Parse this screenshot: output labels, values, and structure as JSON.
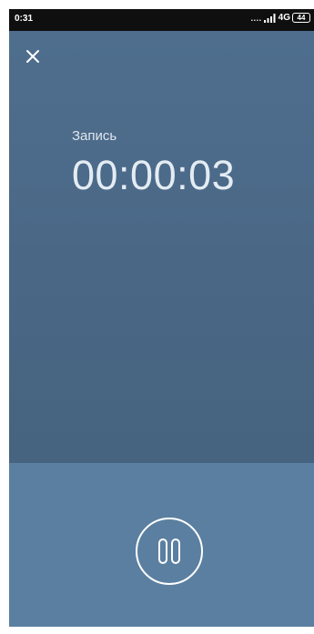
{
  "status_bar": {
    "time": "0:31",
    "signal_dots": "....",
    "network": "4G",
    "battery_level": "44"
  },
  "recording": {
    "label": "Запись",
    "elapsed": "00:00:03"
  },
  "icons": {
    "close": "close-icon",
    "pause": "pause-icon",
    "signal": "signal-bars-icon"
  },
  "colors": {
    "background": "#4b6a8b",
    "bottom_panel": "#5b7fa0",
    "text": "#e4ecf3"
  }
}
